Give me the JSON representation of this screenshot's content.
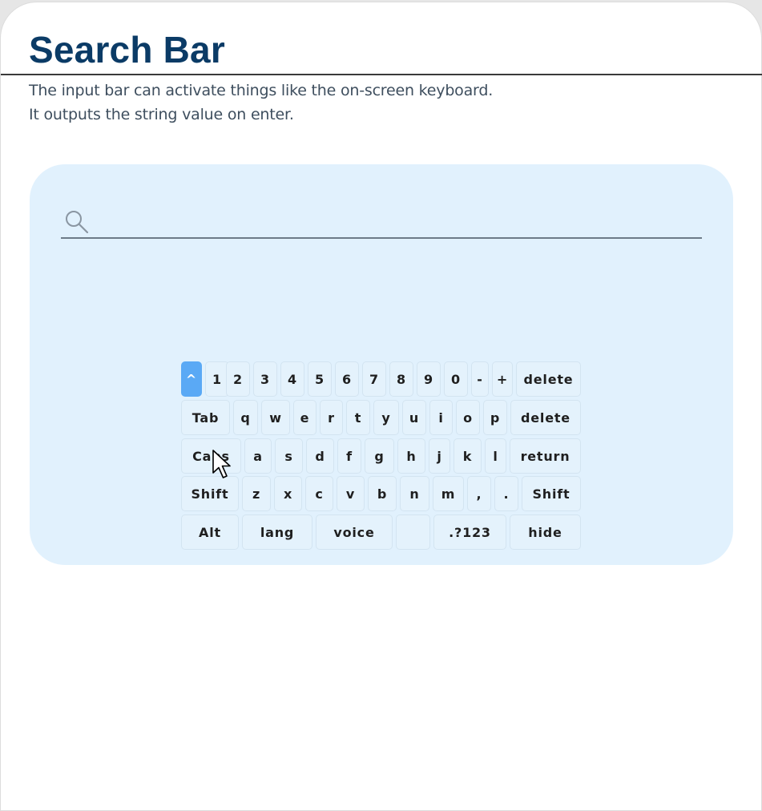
{
  "page": {
    "title": "Search Bar",
    "description_line1": "The input bar can activate things like the on-screen keyboard.",
    "description_line2": "It outputs the string value on enter."
  },
  "search": {
    "placeholder": "",
    "value": "",
    "icon": "search-icon"
  },
  "keyboard": {
    "active_key": "^",
    "rows": [
      [
        "^",
        "1",
        "2",
        "3",
        "4",
        "5",
        "6",
        "7",
        "8",
        "9",
        "0",
        "-",
        "+",
        "delete"
      ],
      [
        "Tab",
        "q",
        "w",
        "e",
        "r",
        "t",
        "y",
        "u",
        "i",
        "o",
        "p",
        "delete"
      ],
      [
        "Caps",
        "a",
        "s",
        "d",
        "f",
        "g",
        "h",
        "j",
        "k",
        "l",
        "return"
      ],
      [
        "Shift",
        "z",
        "x",
        "c",
        "v",
        "b",
        "n",
        "m",
        ",",
        ".",
        "Shift"
      ],
      [
        "Alt",
        "lang",
        "voice",
        "",
        ".?123",
        "hide"
      ]
    ]
  },
  "colors": {
    "title": "#0b3b66",
    "panel_background": "#e1f1fd",
    "active_key": "#5aa9f5",
    "key_background": "#e4f2fc"
  }
}
